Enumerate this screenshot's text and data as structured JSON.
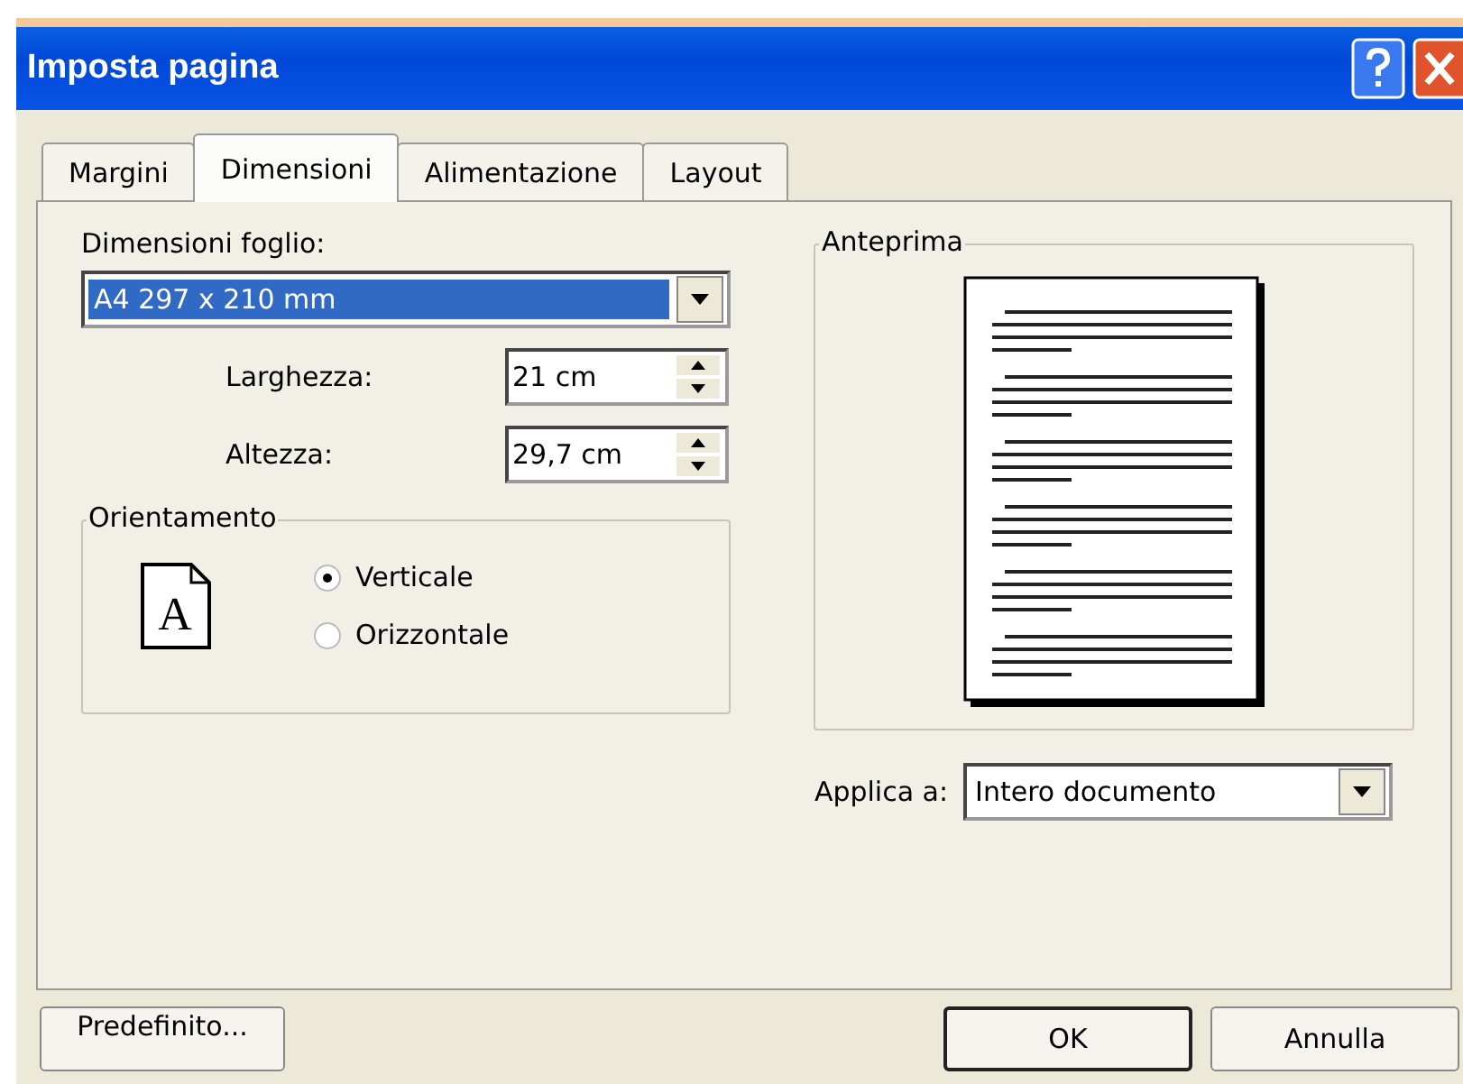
{
  "window": {
    "title": "Imposta pagina"
  },
  "tabs": [
    {
      "label": "Margini",
      "selected": false
    },
    {
      "label": "Dimensioni",
      "selected": true
    },
    {
      "label": "Alimentazione",
      "selected": false
    },
    {
      "label": "Layout",
      "selected": false
    }
  ],
  "paper_size": {
    "label": "Dimensioni foglio:",
    "value": "A4 297 x 210 mm"
  },
  "size_fields": [
    {
      "label": "Larghezza:",
      "value": "21 cm"
    },
    {
      "label": "Altezza:",
      "value": "29,7 cm"
    }
  ],
  "orientation": {
    "title": "Orientamento",
    "icon_letter": "A",
    "options": [
      {
        "label": "Verticale",
        "selected": true
      },
      {
        "label": "Orizzontale",
        "selected": false
      }
    ]
  },
  "preview": {
    "title": "Anteprima"
  },
  "apply_to": {
    "label": "Applica a:",
    "value": "Intero documento"
  },
  "buttons": [
    {
      "label": "Predefinito...",
      "kind": "default"
    },
    {
      "label": "OK",
      "kind": "ok"
    },
    {
      "label": "Annulla",
      "kind": "cancel"
    }
  ]
}
